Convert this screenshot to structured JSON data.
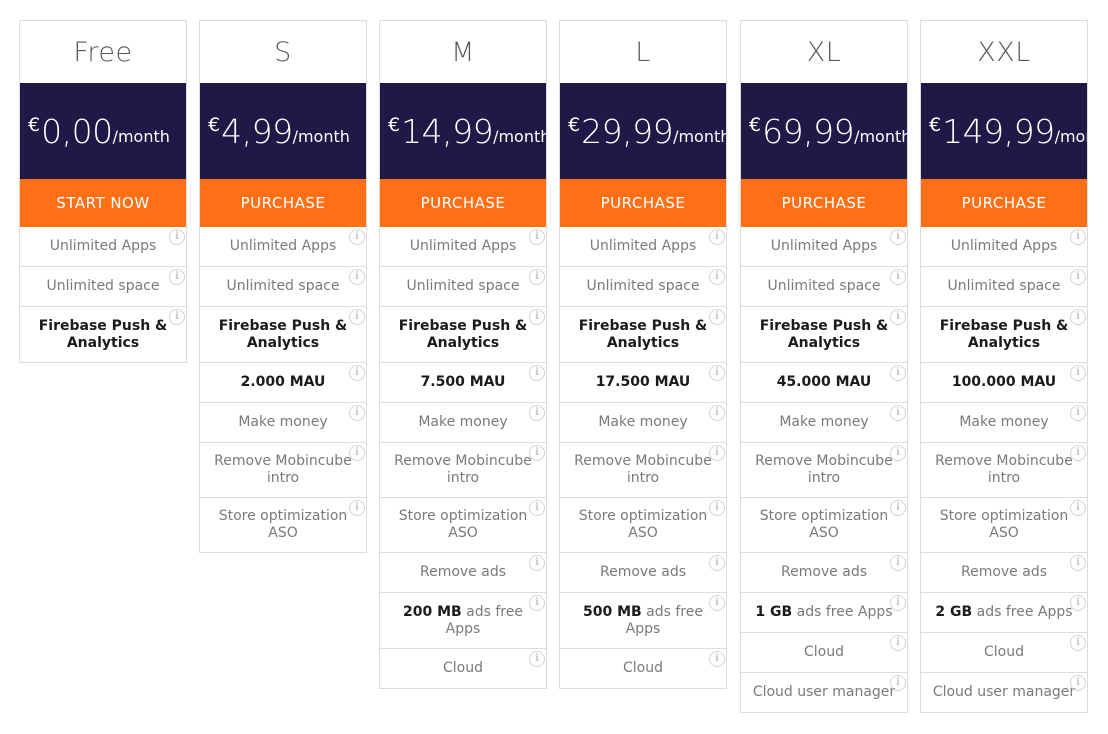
{
  "currency_symbol": "€",
  "period": "/month",
  "info_icon_glyph": "i",
  "colors": {
    "price_bg": "#1f1948",
    "cta_bg": "#fe6f16",
    "border": "#dcdcdc"
  },
  "plans": [
    {
      "name": "Free",
      "price": "0,00",
      "cta": "START NOW",
      "features": [
        {
          "text": "Unlimited Apps"
        },
        {
          "text": "Unlimited space"
        },
        {
          "text": "Firebase Push & Analytics",
          "bold": true
        }
      ]
    },
    {
      "name": "S",
      "price": "4,99",
      "cta": "PURCHASE",
      "features": [
        {
          "text": "Unlimited Apps"
        },
        {
          "text": "Unlimited space"
        },
        {
          "text": "Firebase Push & Analytics",
          "bold": true
        },
        {
          "text": "2.000 MAU",
          "bold": true
        },
        {
          "text": "Make money"
        },
        {
          "text": "Remove Mobincube intro"
        },
        {
          "text": "Store optimization ASO"
        }
      ]
    },
    {
      "name": "M",
      "price": "14,99",
      "cta": "PURCHASE",
      "features": [
        {
          "text": "Unlimited Apps"
        },
        {
          "text": "Unlimited space"
        },
        {
          "text": "Firebase Push & Analytics",
          "bold": true
        },
        {
          "text": "7.500 MAU",
          "bold": true
        },
        {
          "text": "Make money"
        },
        {
          "text": "Remove Mobincube intro"
        },
        {
          "text": "Store optimization ASO"
        },
        {
          "text": "Remove ads"
        },
        {
          "strong": "200 MB",
          "text": " ads free Apps"
        },
        {
          "text": "Cloud"
        }
      ]
    },
    {
      "name": "L",
      "price": "29,99",
      "cta": "PURCHASE",
      "features": [
        {
          "text": "Unlimited Apps"
        },
        {
          "text": "Unlimited space"
        },
        {
          "text": "Firebase Push & Analytics",
          "bold": true
        },
        {
          "text": "17.500 MAU",
          "bold": true
        },
        {
          "text": "Make money"
        },
        {
          "text": "Remove Mobincube intro"
        },
        {
          "text": "Store optimization ASO"
        },
        {
          "text": "Remove ads"
        },
        {
          "strong": "500 MB",
          "text": " ads free Apps"
        },
        {
          "text": "Cloud"
        }
      ]
    },
    {
      "name": "XL",
      "price": "69,99",
      "cta": "PURCHASE",
      "features": [
        {
          "text": "Unlimited Apps"
        },
        {
          "text": "Unlimited space"
        },
        {
          "text": "Firebase Push & Analytics",
          "bold": true
        },
        {
          "text": "45.000 MAU",
          "bold": true
        },
        {
          "text": "Make money"
        },
        {
          "text": "Remove Mobincube intro"
        },
        {
          "text": "Store optimization ASO"
        },
        {
          "text": "Remove ads"
        },
        {
          "strong": "1 GB",
          "text": " ads free Apps"
        },
        {
          "text": "Cloud"
        },
        {
          "text": "Cloud user manager"
        }
      ]
    },
    {
      "name": "XXL",
      "price": "149,99",
      "cta": "PURCHASE",
      "features": [
        {
          "text": "Unlimited Apps"
        },
        {
          "text": "Unlimited space"
        },
        {
          "text": "Firebase Push & Analytics",
          "bold": true
        },
        {
          "text": "100.000 MAU",
          "bold": true
        },
        {
          "text": "Make money"
        },
        {
          "text": "Remove Mobincube intro"
        },
        {
          "text": "Store optimization ASO"
        },
        {
          "text": "Remove ads"
        },
        {
          "strong": "2 GB",
          "text": " ads free Apps"
        },
        {
          "text": "Cloud"
        },
        {
          "text": "Cloud user manager"
        }
      ]
    }
  ]
}
